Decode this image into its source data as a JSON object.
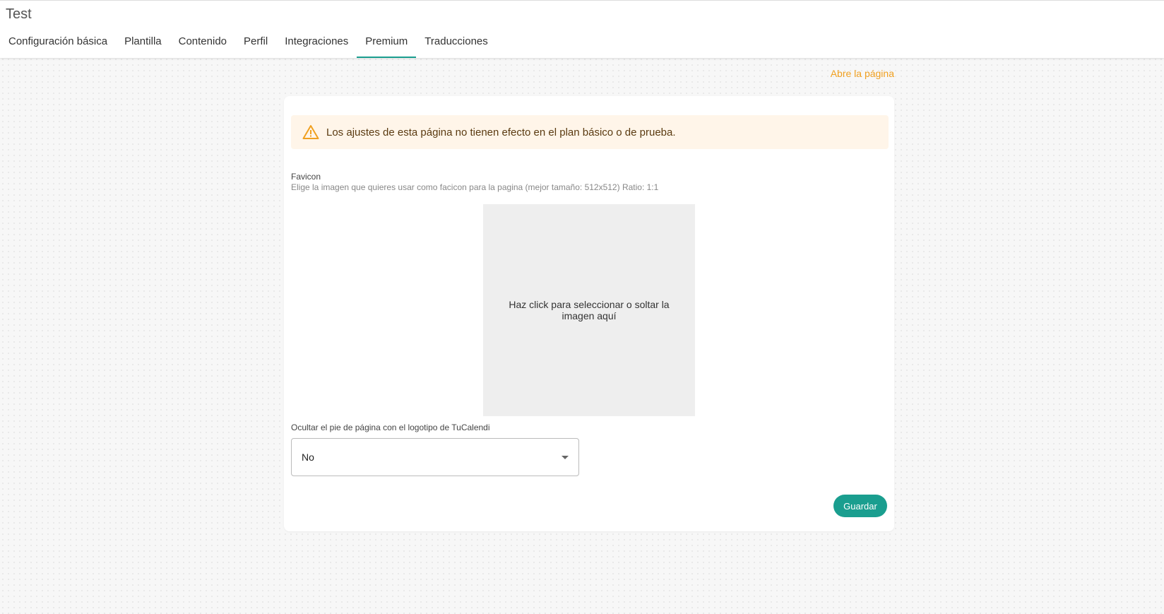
{
  "header": {
    "title": "Test",
    "tabs": [
      {
        "label": "Configuración básica",
        "active": false
      },
      {
        "label": "Plantilla",
        "active": false
      },
      {
        "label": "Contenido",
        "active": false
      },
      {
        "label": "Perfil",
        "active": false
      },
      {
        "label": "Integraciones",
        "active": false
      },
      {
        "label": "Premium",
        "active": true
      },
      {
        "label": "Traducciones",
        "active": false
      }
    ]
  },
  "open_page_link": "Abre la página",
  "alert": {
    "icon": "warning-icon",
    "text": "Los ajustes de esta página no tienen efecto en el plan básico o de prueba."
  },
  "favicon": {
    "label": "Favicon",
    "hint": "Elige la imagen que quieres usar como facicon para la pagina (mejor tamaño: 512x512) Ratio: 1:1",
    "dropzone_text": "Haz click para seleccionar o soltar la imagen aquí"
  },
  "hide_footer": {
    "label": "Ocultar el pie de página con el logotipo de TuCalendi",
    "value": "No"
  },
  "save_label": "Guardar",
  "colors": {
    "accent": "#1a9e8f",
    "link": "#f0a020",
    "alert_bg": "#fff5e9",
    "warning_icon": "#f0a020"
  }
}
